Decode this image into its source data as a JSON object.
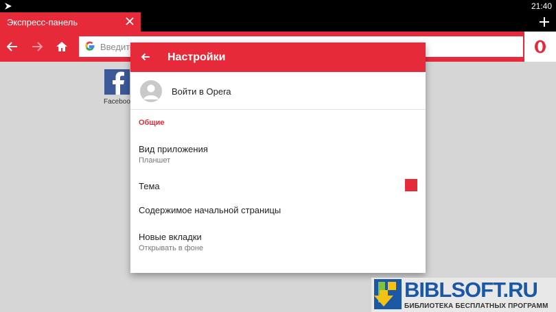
{
  "status_bar": {
    "time": "21:40"
  },
  "tab": {
    "title": "Экспресс-панель"
  },
  "address_bar": {
    "placeholder": "Введите"
  },
  "speed_dial": {
    "tiles": [
      {
        "label": "Facebook"
      }
    ]
  },
  "settings": {
    "title": "Настройки",
    "signin_label": "Войти в Opera",
    "section_general": "Общие",
    "items": [
      {
        "label": "Вид приложения",
        "value": "Планшет"
      },
      {
        "label": "Тема"
      },
      {
        "label": "Содержимое начальной страницы"
      },
      {
        "label": "Новые вкладки",
        "value": "Открывать в фоне"
      }
    ],
    "theme_color": "#e72a39"
  },
  "watermark": {
    "title": "BIBLSOFT.RU",
    "subtitle": "БИБЛИОТЕКА БЕСПЛАТНЫХ ПРОГРАММ"
  },
  "colors": {
    "accent": "#e72a39",
    "dim_background": "#d6d6d6"
  }
}
